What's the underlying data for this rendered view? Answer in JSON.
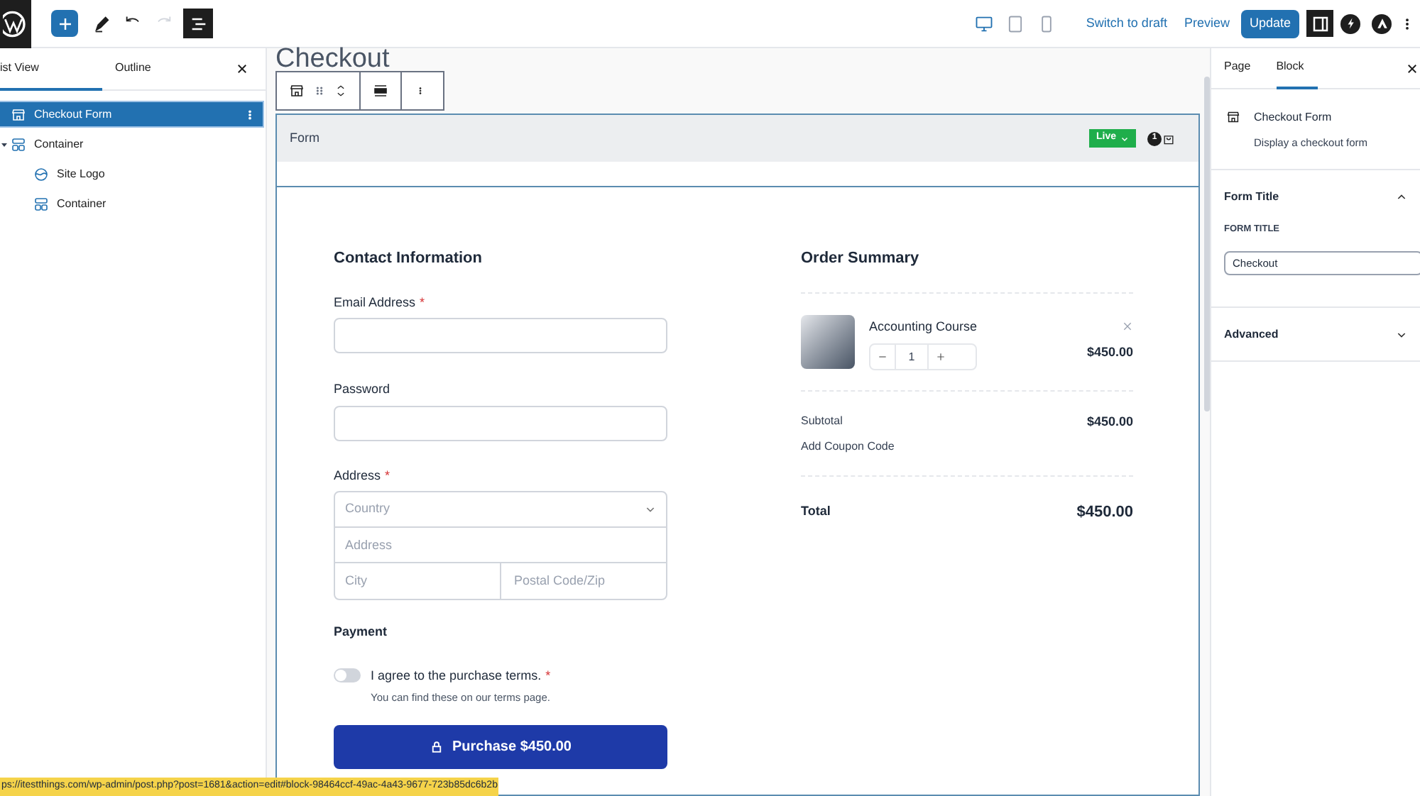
{
  "toolbar": {
    "device_previews": [
      {
        "kind": "desktop",
        "selected": true
      },
      {
        "kind": "tablet",
        "selected": false
      },
      {
        "kind": "mobile",
        "selected": false
      }
    ],
    "switch_to_draft": "Switch to draft",
    "preview": "Preview",
    "update": "Update",
    "settings_toggle": {
      "on": true
    }
  },
  "list_view": {
    "tabs": [
      {
        "label": "ist View",
        "selected": true
      },
      {
        "label": "Outline",
        "selected": false
      }
    ],
    "items": [
      {
        "label": "Checkout Form",
        "kind": "store",
        "selected": true
      },
      {
        "label": "Container",
        "kind": "container",
        "selected": false,
        "expanded": true,
        "children": [
          {
            "label": "Site Logo",
            "kind": "logo",
            "selected": false
          },
          {
            "label": "Container",
            "kind": "container",
            "selected": false
          }
        ]
      }
    ]
  },
  "canvas": {
    "page_title": "Checkout",
    "form_bar": {
      "label": "Form",
      "status": "Live",
      "cart_count": "1"
    },
    "contact": {
      "heading": "Contact Information",
      "fields": [
        {
          "label": "Email Address",
          "required_mark": "*"
        },
        {
          "label": "Password"
        }
      ],
      "address": {
        "label": "Address",
        "required_mark": "*",
        "country_placeholder": "Country",
        "address_placeholder": "Address",
        "city_placeholder": "City",
        "zip_placeholder": "Postal Code/Zip"
      },
      "payment": {
        "heading": "Payment",
        "terms": {
          "checked": false,
          "label": "I agree to the purchase terms.",
          "required_mark": "*",
          "hint": "You can find these on our terms page."
        },
        "button": "Purchase $450.00"
      }
    },
    "summary": {
      "heading": "Order Summary",
      "item": {
        "name": "Accounting Course",
        "quantity": "1",
        "price": "$450.00"
      },
      "subtotal_label": "Subtotal",
      "subtotal": "$450.00",
      "coupon": "Add Coupon Code",
      "total_label": "Total",
      "total": "$450.00"
    }
  },
  "inspector": {
    "tabs": [
      {
        "label": "Page",
        "selected": false
      },
      {
        "label": "Block",
        "selected": true
      }
    ],
    "block_name": "Checkout Form",
    "block_description": "Display a checkout form",
    "panels": [
      {
        "title": "Form Title",
        "expanded": true,
        "field_label": "FORM TITLE",
        "field_value": "Checkout"
      },
      {
        "title": "Advanced",
        "expanded": false
      }
    ]
  },
  "status_url": "ps://itestthings.com/wp-admin/post.php?post=1681&action=edit#block-98464ccf-49ac-4a43-9677-723b85dc6b2b"
}
